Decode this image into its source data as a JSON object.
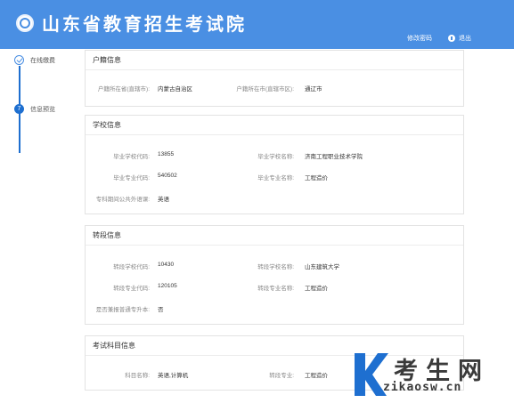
{
  "header": {
    "title": "山东省教育招生考试院",
    "change_password": "修改密码",
    "logout": "退出",
    "bg_color": "#4a8fe3"
  },
  "steps": {
    "items": [
      {
        "label": "在线缴费",
        "status": "done",
        "icon": "check-circle-icon"
      },
      {
        "label": "信息预览",
        "number": "7",
        "status": "current"
      }
    ],
    "accent_color": "#1e6fd0"
  },
  "sections": {
    "huji": {
      "title": "户籍信息",
      "province_label": "户籍所在省(直辖市):",
      "province_value": "内蒙古自治区",
      "city_label": "户籍所在市(直辖市区):",
      "city_value": "通辽市"
    },
    "school": {
      "title": "学校信息",
      "school_code_label": "毕业学校代码:",
      "school_code_value": "13855",
      "school_name_label": "毕业学校名称:",
      "school_name_value": "济南工程职业技术学院",
      "major_code_label": "毕业专业代码:",
      "major_code_value": "540502",
      "major_name_label": "毕业专业名称:",
      "major_name_value": "工程造价",
      "language_label": "专科期间公共外语课:",
      "language_value": "英语"
    },
    "zhuan": {
      "title": "转段信息",
      "school_code_label": "转段学校代码:",
      "school_code_value": "10430",
      "school_name_label": "转段学校名称:",
      "school_name_value": "山东建筑大学",
      "major_code_label": "转段专业代码:",
      "major_code_value": "120105",
      "major_name_label": "转段专业名称:",
      "major_name_value": "工程造价",
      "regular_label": "是否兼报普通专升本:",
      "regular_value": "否"
    },
    "exam": {
      "title": "考试科目信息",
      "subject_label": "科目名称:",
      "subject_value": "英语,计算机",
      "major_label": "转段专业:",
      "major_value": "工程造价"
    }
  },
  "watermark": {
    "big_text": "考生网",
    "small_text": "zikaosw.cn",
    "k_color": "#1e6fd0"
  }
}
